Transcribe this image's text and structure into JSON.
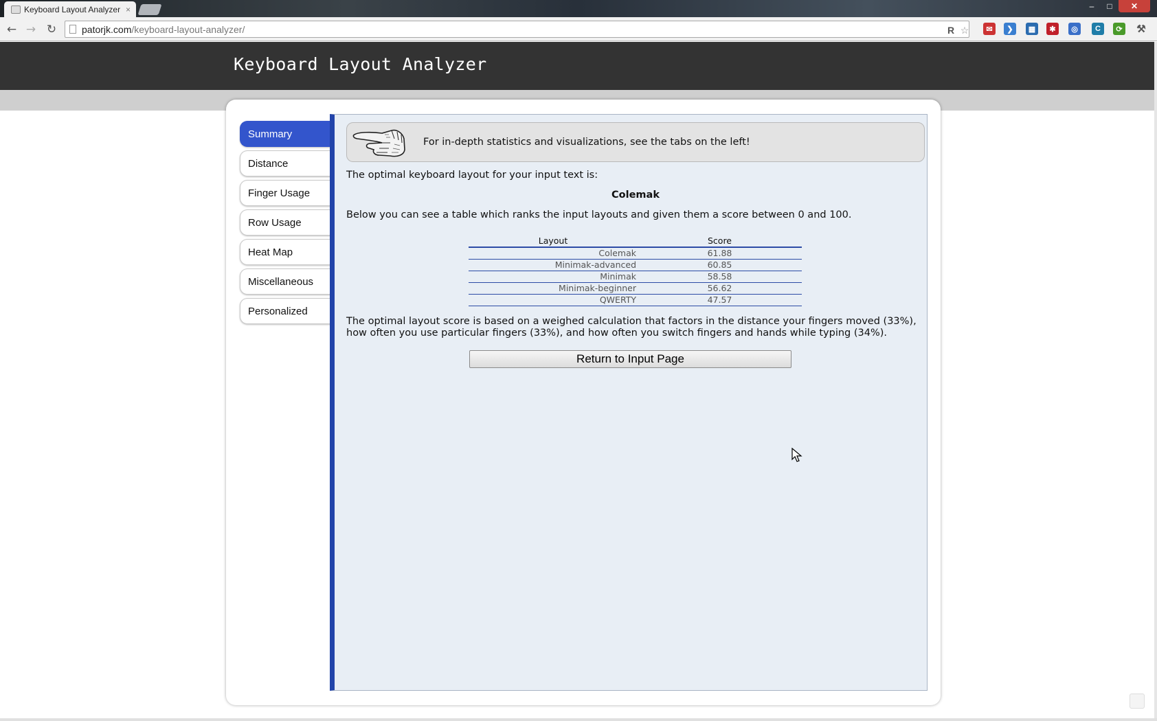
{
  "browser": {
    "tab_title": "Keyboard Layout Analyzer",
    "tab_close": "×",
    "url_host": "patorjk.com",
    "url_path": "/keyboard-layout-analyzer/",
    "window_controls": {
      "minimize": "–",
      "maximize": "□",
      "close": "✕"
    },
    "nav": {
      "back": "←",
      "forward": "→",
      "reload": "↻"
    }
  },
  "header": {
    "title": "Keyboard Layout Analyzer"
  },
  "sidebar": {
    "items": [
      {
        "label": "Summary",
        "active": true
      },
      {
        "label": "Distance"
      },
      {
        "label": "Finger Usage"
      },
      {
        "label": "Row Usage"
      },
      {
        "label": "Heat Map"
      },
      {
        "label": "Miscellaneous"
      },
      {
        "label": "Personalized"
      }
    ]
  },
  "summary": {
    "tip": "For in-depth statistics and visualizations, see the tabs on the left!",
    "intro": "The optimal keyboard layout for your input text is:",
    "best_layout": "Colemak",
    "table_intro": "Below you can see a table which ranks the input layouts and given them a score between 0 and 100.",
    "table": {
      "headers": [
        "Layout",
        "Score"
      ],
      "rows": [
        [
          "Colemak",
          "61.88"
        ],
        [
          "Minimak-advanced",
          "60.85"
        ],
        [
          "Minimak",
          "58.58"
        ],
        [
          "Minimak-beginner",
          "56.62"
        ],
        [
          "QWERTY",
          "47.57"
        ]
      ]
    },
    "explanation": "The optimal layout score is based on a weighed calculation that factors in the distance your fingers moved (33%), how often you use particular fingers (33%), and how often you switch fingers and hands while typing (34%).",
    "return_button": "Return to Input Page"
  },
  "colors": {
    "header_bg": "#333333",
    "accent_blue": "#3355cc",
    "panel_bg": "#e8eef5"
  }
}
